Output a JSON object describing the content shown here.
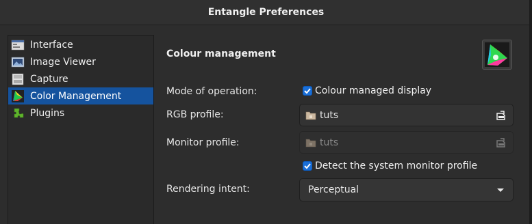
{
  "window": {
    "title": "Entangle Preferences"
  },
  "sidebar": {
    "items": [
      {
        "label": "Interface",
        "icon": "interface-icon",
        "selected": false
      },
      {
        "label": "Image Viewer",
        "icon": "image-viewer-icon",
        "selected": false
      },
      {
        "label": "Capture",
        "icon": "capture-icon",
        "selected": false
      },
      {
        "label": "Color Management",
        "icon": "color-management-icon",
        "selected": true
      },
      {
        "label": "Plugins",
        "icon": "plugins-icon",
        "selected": false
      }
    ]
  },
  "main": {
    "heading": "Colour management",
    "mode": {
      "label": "Mode of operation:",
      "checkbox_label": "Colour managed display",
      "checked": true
    },
    "rgb_profile": {
      "label": "RGB profile:",
      "value": "tuts",
      "enabled": true
    },
    "monitor_profile": {
      "label": "Monitor profile:",
      "value": "tuts",
      "enabled": false
    },
    "detect": {
      "checkbox_label": "Detect the system monitor profile",
      "checked": true
    },
    "rendering_intent": {
      "label": "Rendering intent:",
      "selected": "Perceptual"
    }
  },
  "colors": {
    "selection": "#15539e",
    "checkbox": "#1a6fd8",
    "background": "#2d2d2d"
  }
}
